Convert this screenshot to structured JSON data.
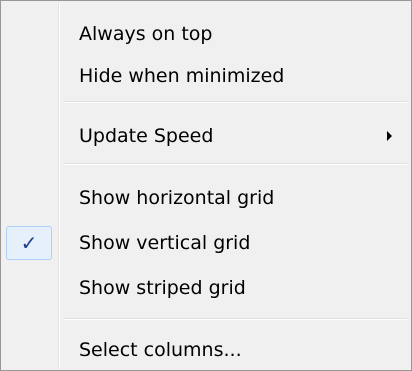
{
  "menu": {
    "items": [
      {
        "label": "Always on top"
      },
      {
        "label": "Hide when minimized"
      },
      {
        "label": "Update Speed",
        "has_submenu": true
      },
      {
        "label": "Show horizontal grid"
      },
      {
        "label": "Show vertical grid",
        "checked": true,
        "check_glyph": "✓"
      },
      {
        "label": "Show striped grid"
      },
      {
        "label": "Select columns..."
      }
    ]
  },
  "colors": {
    "menu_background": "#f0f0f0",
    "menu_border": "#979797",
    "check_highlight": "#e6f0fa",
    "check_border": "#aecff7",
    "check_mark": "#1b3f8f"
  },
  "icons": {
    "submenu_arrow": "chevron-right-icon",
    "check": "checkmark-icon"
  }
}
